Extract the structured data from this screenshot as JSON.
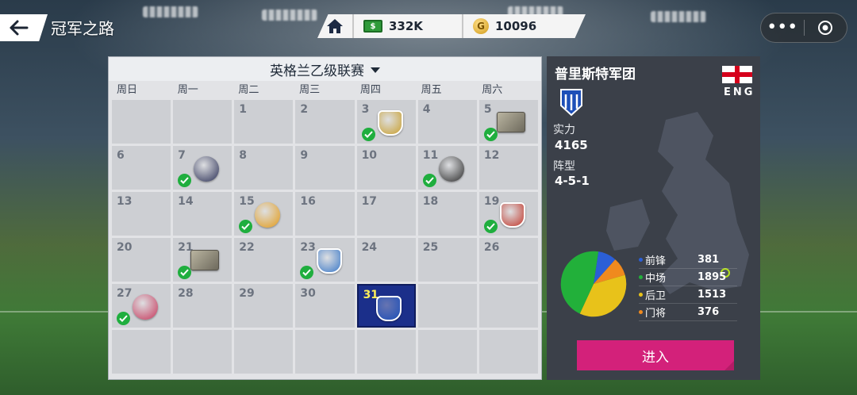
{
  "header": {
    "title": "冠军之路",
    "currency": {
      "cash": "332K",
      "coins": "10096",
      "coin_symbol": "G"
    }
  },
  "calendar": {
    "league": "英格兰乙级联赛",
    "weekdays": [
      "周日",
      "周一",
      "周二",
      "周三",
      "周四",
      "周五",
      "周六"
    ],
    "days": [
      {
        "n": "",
        "empty": true
      },
      {
        "n": "",
        "empty": true
      },
      {
        "n": "1"
      },
      {
        "n": "2"
      },
      {
        "n": "3",
        "done": true,
        "badge": "shield",
        "color": "#c9a030"
      },
      {
        "n": "4"
      },
      {
        "n": "5",
        "done": true,
        "badge": "card"
      },
      {
        "n": "6"
      },
      {
        "n": "7",
        "done": true,
        "badge": "round",
        "color": "#2a2f55"
      },
      {
        "n": "8"
      },
      {
        "n": "9"
      },
      {
        "n": "10"
      },
      {
        "n": "11",
        "done": true,
        "badge": "round",
        "color": "#2b2b2b"
      },
      {
        "n": "12"
      },
      {
        "n": "13"
      },
      {
        "n": "14"
      },
      {
        "n": "15",
        "done": true,
        "badge": "round",
        "color": "#e39a16"
      },
      {
        "n": "16"
      },
      {
        "n": "17"
      },
      {
        "n": "18"
      },
      {
        "n": "19",
        "done": true,
        "badge": "shield",
        "color": "#c23a2e"
      },
      {
        "n": "20"
      },
      {
        "n": "21",
        "done": true,
        "badge": "card"
      },
      {
        "n": "22"
      },
      {
        "n": "23",
        "done": true,
        "badge": "shield",
        "color": "#3b79c8"
      },
      {
        "n": "24"
      },
      {
        "n": "25"
      },
      {
        "n": "26"
      },
      {
        "n": "27",
        "done": true,
        "badge": "round",
        "color": "#c6365a"
      },
      {
        "n": "28"
      },
      {
        "n": "29"
      },
      {
        "n": "30"
      },
      {
        "n": "31",
        "today": true,
        "badge": "shield",
        "color": "#1d4fb8"
      },
      {
        "n": "",
        "empty": true
      },
      {
        "n": "",
        "empty": true
      },
      {
        "n": "",
        "empty": true
      },
      {
        "n": "",
        "empty": true
      },
      {
        "n": "",
        "empty": true
      },
      {
        "n": "",
        "empty": true
      },
      {
        "n": "",
        "empty": true
      },
      {
        "n": "",
        "empty": true
      },
      {
        "n": "",
        "empty": true
      }
    ]
  },
  "team": {
    "name": "普里斯特军团",
    "country_code": "ENG",
    "strength_label": "实力",
    "strength": "4165",
    "formation_label": "阵型",
    "formation": "4-5-1",
    "positions": [
      {
        "label": "前锋",
        "value": "381",
        "color": "#2b5fd6"
      },
      {
        "label": "中场",
        "value": "1895",
        "color": "#22b03a"
      },
      {
        "label": "后卫",
        "value": "1513",
        "color": "#e8c21a"
      },
      {
        "label": "门将",
        "value": "376",
        "color": "#f08a1e"
      }
    ],
    "enter_label": "进入"
  }
}
